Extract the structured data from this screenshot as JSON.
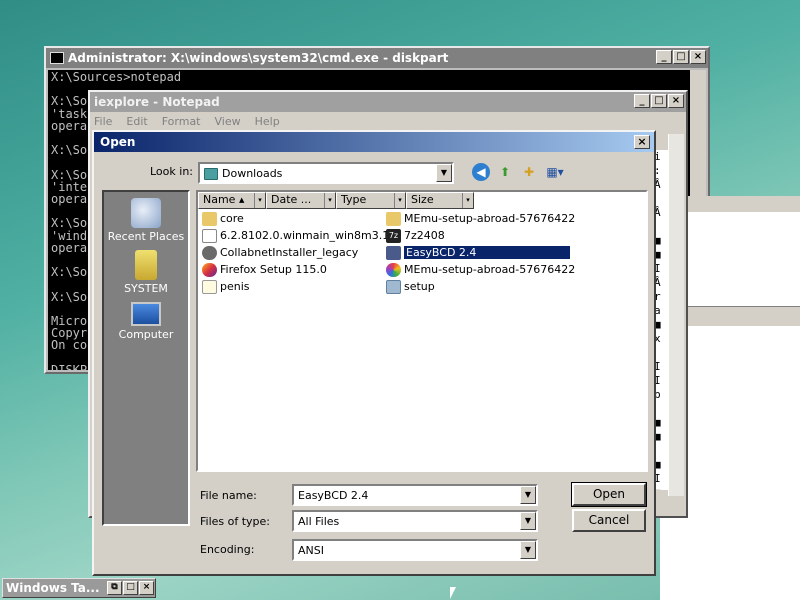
{
  "cmd": {
    "title": "Administrator: X:\\windows\\system32\\cmd.exe - diskpart",
    "lines": "X:\\Sources>notepad\n\nX:\\So\n'task\nopera\n\nX:\\So\n\nX:\\So\n'inte\nopera\n\nX:\\So\n'wind\nopera\n\nX:\\So\n\nX:\\So\n\nMicro\nCopyr\nOn co\n\nDISKP"
  },
  "notepad": {
    "title": "iexplore - Notepad",
    "menu": [
      "File",
      "Edit",
      "Format",
      "View",
      "Help"
    ],
    "side_glyphs": "i\n:\nÂ\n\nÂ\n\n■\n■\nI\nÂ\nr\na\n■\nx\n\nI\nI\nb\n\n■\n■\n\n■\nI\n■\n@\n■"
  },
  "dialog": {
    "title": "Open",
    "lookin_label": "Look in:",
    "lookin_value": "Downloads",
    "places": [
      {
        "label": "Recent Places",
        "icon": "recent-places-icon"
      },
      {
        "label": "SYSTEM",
        "icon": "user-folder-icon"
      },
      {
        "label": "Computer",
        "icon": "computer-icon"
      }
    ],
    "columns": [
      "Name",
      "Date ...",
      "Type",
      "Size"
    ],
    "files_left": [
      {
        "name": "core",
        "icon": "folder-icon"
      },
      {
        "name": "6.2.8102.0.winmain_win8m3.1...",
        "icon": "file-icon"
      },
      {
        "name": "CollabnetInstaller_legacy",
        "icon": "installer-icon"
      },
      {
        "name": "Firefox Setup 115.0",
        "icon": "firefox-icon"
      },
      {
        "name": "penis",
        "icon": "text-file-icon"
      }
    ],
    "files_right": [
      {
        "name": "MEmu-setup-abroad-57676422",
        "icon": "folder-icon"
      },
      {
        "name": "7z2408",
        "icon": "7zip-icon"
      },
      {
        "name": "EasyBCD 2.4",
        "icon": "easybcd-icon",
        "selected": true
      },
      {
        "name": "MEmu-setup-abroad-57676422",
        "icon": "memu-icon"
      },
      {
        "name": "setup",
        "icon": "setup-icon"
      }
    ],
    "filename_label": "File name:",
    "filename_value": "EasyBCD 2.4",
    "filetype_label": "Files of type:",
    "filetype_value": "All Files",
    "encoding_label": "Encoding:",
    "encoding_value": "ANSI",
    "open_button": "Open",
    "cancel_button": "Cancel"
  },
  "taskbar": {
    "item_label": "Windows Ta..."
  },
  "colors": {
    "titlebar_active": "#0a246a",
    "selection": "#0a246a",
    "face": "#d4d0c8"
  }
}
